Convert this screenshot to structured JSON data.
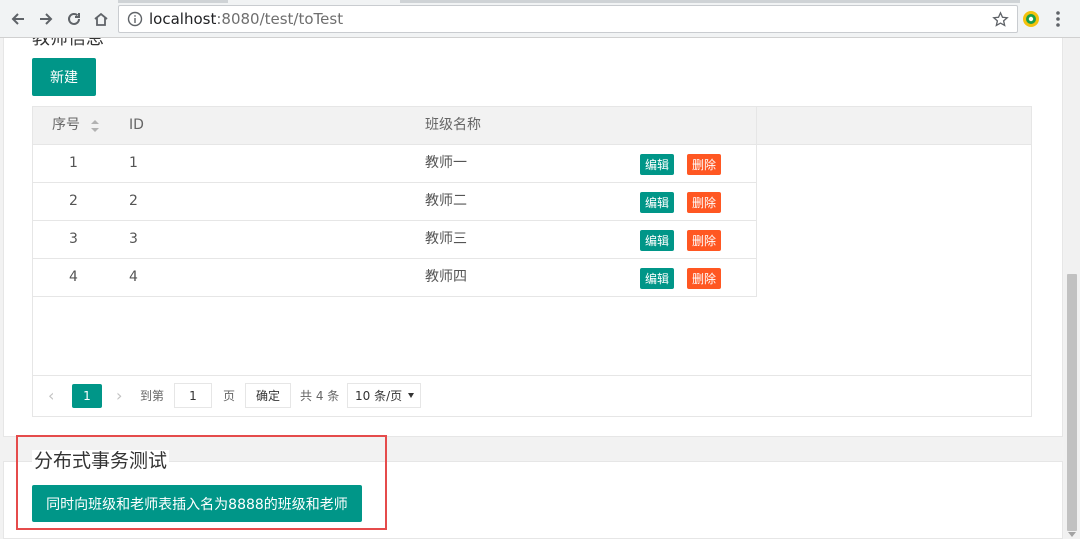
{
  "browser": {
    "url_host": "localhost",
    "url_rest": ":8080/test/toTest"
  },
  "card1": {
    "title": "教师信息",
    "new_button": "新建",
    "table": {
      "headers": {
        "index": "序号",
        "id": "ID",
        "name": "班级名称"
      },
      "rows": [
        {
          "index": "1",
          "id": "1",
          "name": "教师一"
        },
        {
          "index": "2",
          "id": "2",
          "name": "教师二"
        },
        {
          "index": "3",
          "id": "3",
          "name": "教师三"
        },
        {
          "index": "4",
          "id": "4",
          "name": "教师四"
        }
      ],
      "edit_label": "编辑",
      "delete_label": "删除"
    },
    "pager": {
      "current_page": "1",
      "goto_label": "到第",
      "page_input": "1",
      "page_unit": "页",
      "confirm": "确定",
      "total": "共 4 条",
      "page_size": "10 条/页"
    }
  },
  "card2": {
    "title": "分布式事务测试",
    "button": "同时向班级和老师表插入名为8888的班级和老师"
  },
  "colors": {
    "primary": "#009688",
    "danger": "#ff5722",
    "highlight": "#e54b4b"
  }
}
